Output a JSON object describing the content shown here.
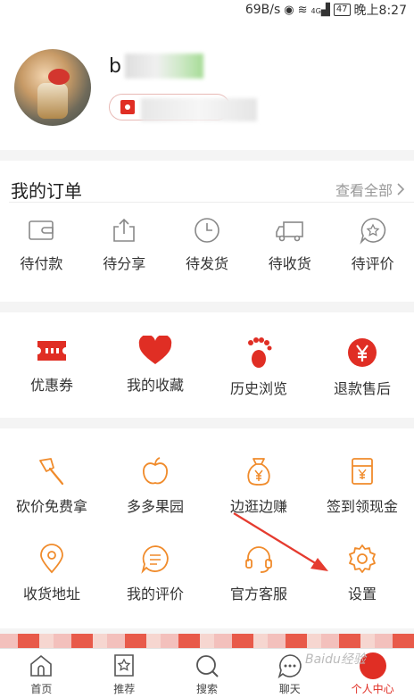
{
  "status_bar": {
    "speed": "69B/s",
    "network": "4G",
    "battery": "47",
    "time": "晚上8:27"
  },
  "profile": {
    "name_initial": "b"
  },
  "orders": {
    "title": "我的订单",
    "view_all": "查看全部",
    "items": [
      {
        "label": "待付款",
        "icon": "wallet-icon"
      },
      {
        "label": "待分享",
        "icon": "share-icon"
      },
      {
        "label": "待发货",
        "icon": "clock-icon"
      },
      {
        "label": "待收货",
        "icon": "truck-icon"
      },
      {
        "label": "待评价",
        "icon": "review-icon"
      }
    ]
  },
  "services": [
    {
      "label": "优惠券",
      "icon": "coupon-icon"
    },
    {
      "label": "我的收藏",
      "icon": "heart-icon"
    },
    {
      "label": "历史浏览",
      "icon": "footprint-icon"
    },
    {
      "label": "退款售后",
      "icon": "refund-icon"
    }
  ],
  "tools": [
    {
      "label": "砍价免费拿",
      "icon": "axe-icon"
    },
    {
      "label": "多多果园",
      "icon": "apple-icon"
    },
    {
      "label": "边逛边赚",
      "icon": "money-bag-icon"
    },
    {
      "label": "签到领现金",
      "icon": "checkin-icon"
    },
    {
      "label": "收货地址",
      "icon": "location-icon"
    },
    {
      "label": "我的评价",
      "icon": "comment-icon"
    },
    {
      "label": "官方客服",
      "icon": "headset-icon"
    },
    {
      "label": "设置",
      "icon": "gear-icon"
    }
  ],
  "tabs": [
    {
      "label": "首页",
      "icon": "home-icon"
    },
    {
      "label": "推荐",
      "icon": "recommend-icon"
    },
    {
      "label": "搜索",
      "icon": "search-icon"
    },
    {
      "label": "聊天",
      "icon": "chat-icon"
    },
    {
      "label": "个人中心",
      "icon": "profile-icon",
      "active": true
    }
  ],
  "watermark": "Baidu经验",
  "colors": {
    "brand_red": "#e02e24",
    "tool_orange": "#f08b2b",
    "order_gray": "#888888"
  }
}
